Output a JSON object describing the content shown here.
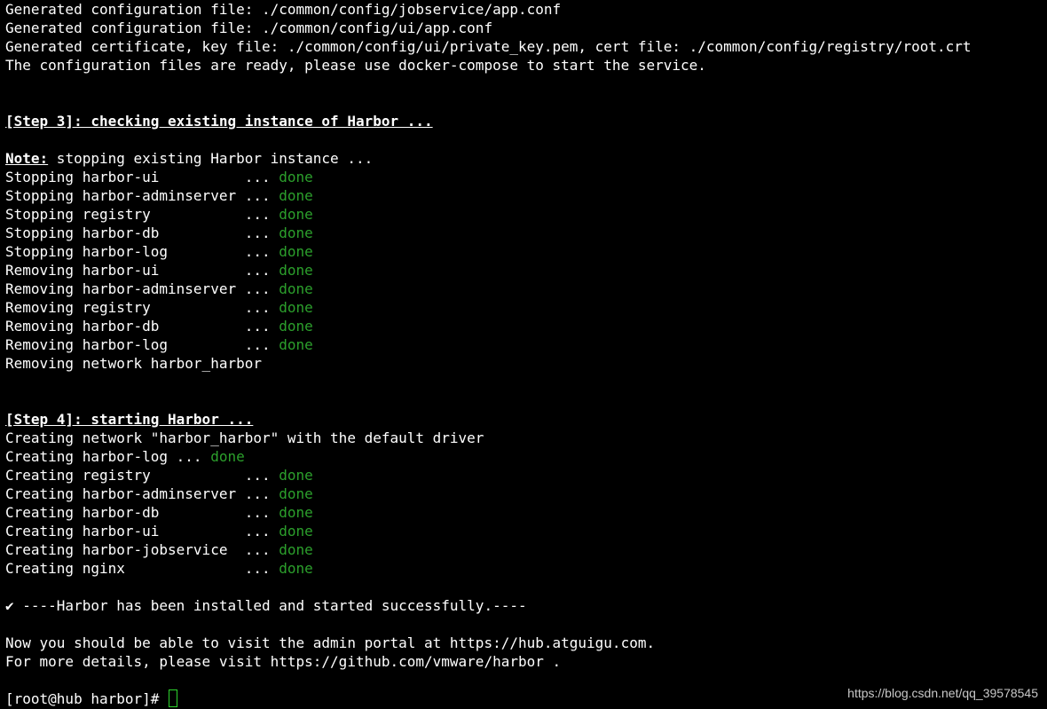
{
  "lines": [
    {
      "type": "text",
      "text": "Generated configuration file: ./common/config/jobservice/app.conf"
    },
    {
      "type": "text",
      "text": "Generated configuration file: ./common/config/ui/app.conf"
    },
    {
      "type": "text",
      "text": "Generated certificate, key file: ./common/config/ui/private_key.pem, cert file: ./common/config/registry/root.crt"
    },
    {
      "type": "text",
      "text": "The configuration files are ready, please use docker-compose to start the service."
    },
    {
      "type": "blank"
    },
    {
      "type": "blank"
    },
    {
      "type": "heading",
      "text": "[Step 3]: checking existing instance of Harbor ..."
    },
    {
      "type": "blank"
    },
    {
      "type": "note",
      "label": "Note:",
      "text": " stopping existing Harbor instance ..."
    },
    {
      "type": "status",
      "text": "Stopping harbor-ui          ... ",
      "status": "done"
    },
    {
      "type": "status",
      "text": "Stopping harbor-adminserver ... ",
      "status": "done"
    },
    {
      "type": "status",
      "text": "Stopping registry           ... ",
      "status": "done"
    },
    {
      "type": "status",
      "text": "Stopping harbor-db          ... ",
      "status": "done"
    },
    {
      "type": "status",
      "text": "Stopping harbor-log         ... ",
      "status": "done"
    },
    {
      "type": "status",
      "text": "Removing harbor-ui          ... ",
      "status": "done"
    },
    {
      "type": "status",
      "text": "Removing harbor-adminserver ... ",
      "status": "done"
    },
    {
      "type": "status",
      "text": "Removing registry           ... ",
      "status": "done"
    },
    {
      "type": "status",
      "text": "Removing harbor-db          ... ",
      "status": "done"
    },
    {
      "type": "status",
      "text": "Removing harbor-log         ... ",
      "status": "done"
    },
    {
      "type": "text",
      "text": "Removing network harbor_harbor"
    },
    {
      "type": "blank"
    },
    {
      "type": "blank"
    },
    {
      "type": "heading",
      "text": "[Step 4]: starting Harbor ..."
    },
    {
      "type": "text",
      "text": "Creating network \"harbor_harbor\" with the default driver"
    },
    {
      "type": "status",
      "text": "Creating harbor-log ... ",
      "status": "done"
    },
    {
      "type": "status",
      "text": "Creating registry           ... ",
      "status": "done"
    },
    {
      "type": "status",
      "text": "Creating harbor-adminserver ... ",
      "status": "done"
    },
    {
      "type": "status",
      "text": "Creating harbor-db          ... ",
      "status": "done"
    },
    {
      "type": "status",
      "text": "Creating harbor-ui          ... ",
      "status": "done"
    },
    {
      "type": "status",
      "text": "Creating harbor-jobservice  ... ",
      "status": "done"
    },
    {
      "type": "status",
      "text": "Creating nginx              ... ",
      "status": "done"
    },
    {
      "type": "blank"
    },
    {
      "type": "text",
      "text": "✔ ----Harbor has been installed and started successfully.----"
    },
    {
      "type": "blank"
    },
    {
      "type": "text",
      "text": "Now you should be able to visit the admin portal at https://hub.atguigu.com."
    },
    {
      "type": "text",
      "text": "For more details, please visit https://github.com/vmware/harbor ."
    },
    {
      "type": "blank"
    },
    {
      "type": "prompt",
      "text": "[root@hub harbor]# "
    }
  ],
  "watermark": "https://blog.csdn.net/qq_39578545",
  "colors": {
    "background": "#000000",
    "text": "#ffffff",
    "done": "#2ca02c",
    "cursor": "#2dd32d"
  }
}
